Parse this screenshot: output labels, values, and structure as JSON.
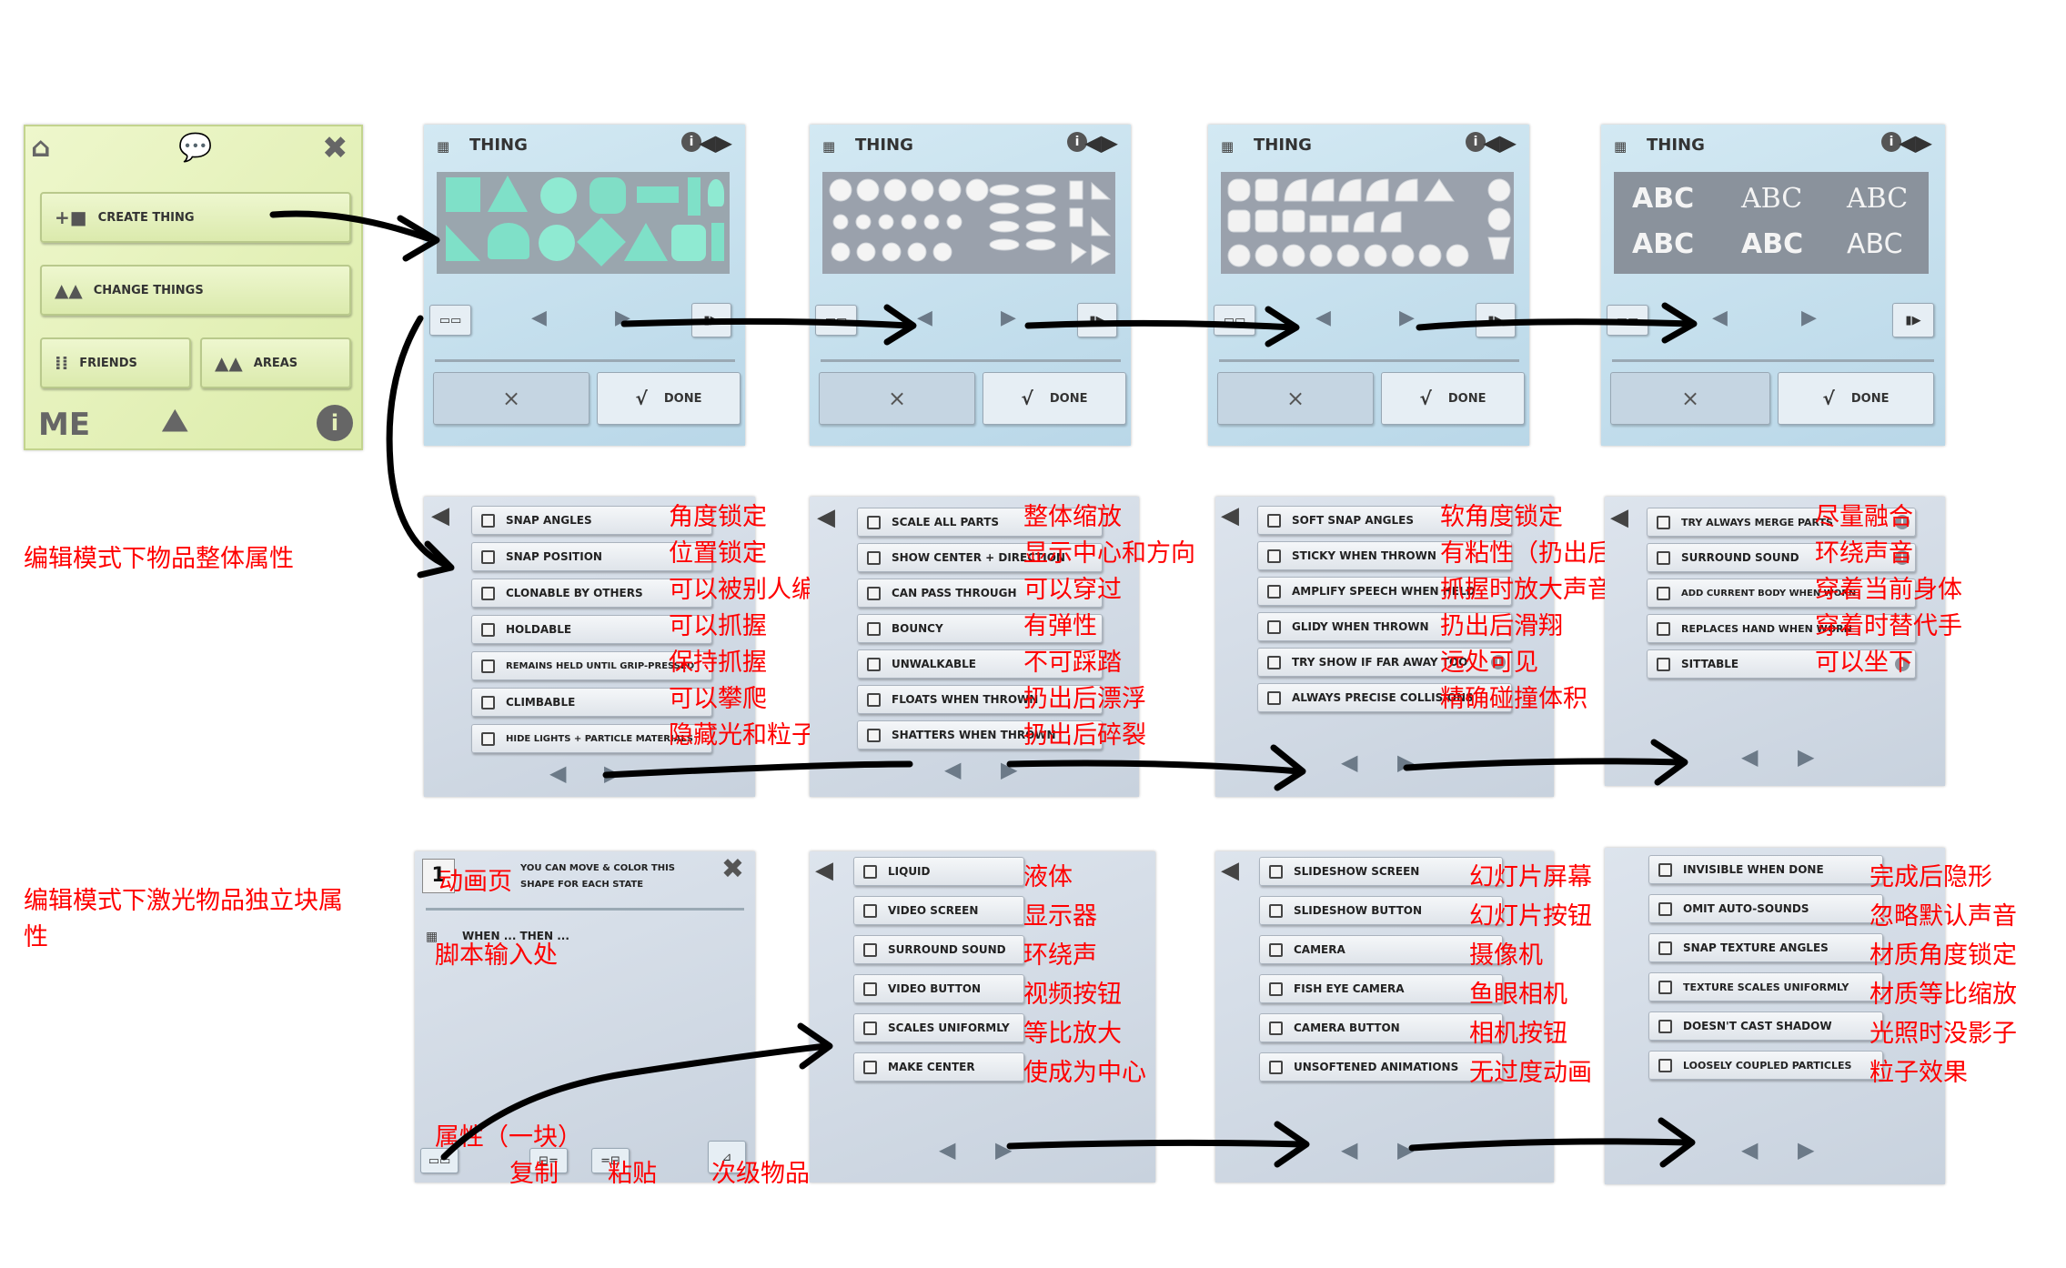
{
  "colors": {
    "annotation": "#ff0000",
    "main_menu_bg": "#e4f0b8",
    "thing_panel_bg": "#c7e0ee",
    "options_panel_bg": "#d2dae4"
  },
  "main_menu": {
    "create_thing": "CREATE THING",
    "change_things": "CHANGE THINGS",
    "friends": "FRIENDS",
    "areas": "AREAS",
    "me": "ME",
    "icons": [
      "home-icon",
      "chat-bubble-icon",
      "close-icon",
      "mountains-icon",
      "info-icon"
    ]
  },
  "thing_panel": {
    "title": "THING",
    "done_label": "DONE",
    "cancel_glyph": "×",
    "done_glyph": "√"
  },
  "text_abc": [
    "ABC",
    "ABC",
    "ABC",
    "ABC",
    "ABC",
    "ABC"
  ],
  "labels": {
    "edit_whole": "编辑模式下物品整体属性",
    "edit_laser_line1": "编辑模式下激光物品独立块属",
    "edit_laser_line2": "性"
  },
  "row1": {
    "options": [
      "SNAP ANGLES",
      "SNAP POSITION",
      "CLONABLE BY OTHERS",
      "HOLDABLE",
      "REMAINS HELD UNTIL GRIP-PRESSED",
      "CLIMBABLE",
      "HIDE LIGHTS + PARTICLE MATERIALS"
    ],
    "cn": [
      "角度锁定",
      "位置锁定",
      "可以被别人编辑",
      "可以抓握",
      "保持抓握",
      "可以攀爬",
      "隐藏光和粒子"
    ]
  },
  "row2": {
    "options": [
      "SCALE ALL PARTS",
      "SHOW CENTER + DIRECTION",
      "CAN PASS THROUGH",
      "BOUNCY",
      "UNWALKABLE",
      "FLOATS WHEN THROWN",
      "SHATTERS WHEN THROWN"
    ],
    "cn": [
      "整体缩放",
      "显示中心和方向",
      "可以穿过",
      "有弹性",
      "不可踩踏",
      "扔出后漂浮",
      "扔出后碎裂"
    ]
  },
  "row3": {
    "options": [
      "SOFT SNAP ANGLES",
      "STICKY WHEN THROWN",
      "AMPLIFY SPEECH WHEN HELD",
      "GLIDY WHEN THROWN",
      "TRY SHOW IF FAR AWAY TOO",
      "ALWAYS PRECISE COLLISIONS"
    ],
    "cn": [
      "软角度锁定",
      "有粘性（扔出后）",
      "抓握时放大声音",
      "扔出后滑翔",
      "远处可见",
      "精确碰撞体积"
    ]
  },
  "row4": {
    "options": [
      "TRY ALWAYS MERGE PARTS",
      "SURROUND SOUND",
      "ADD CURRENT BODY WHEN WORN",
      "REPLACES HAND WHEN WORN",
      "SITTABLE"
    ],
    "cn": [
      "尽量融合",
      "环绕声音",
      "穿着当前身体",
      "穿着时替代手",
      "可以坐下"
    ]
  },
  "part_panel": {
    "note": "YOU CAN MOVE & COLOR THIS SHAPE FOR EACH STATE",
    "state_num": "1",
    "when_then": "WHEN ... THEN ...",
    "cn_anim": "动画页",
    "cn_script": "脚本输入处",
    "cn_props": "属性（一块）",
    "cn_copy": "复制",
    "cn_paste": "粘贴",
    "cn_sub": "次级物品"
  },
  "row5": {
    "options": [
      "LIQUID",
      "VIDEO SCREEN",
      "SURROUND SOUND",
      "VIDEO BUTTON",
      "SCALES UNIFORMLY",
      "MAKE CENTER"
    ],
    "cn": [
      "液体",
      "显示器",
      "环绕声",
      "视频按钮",
      "等比放大",
      "使成为中心"
    ]
  },
  "row6": {
    "options": [
      "SLIDESHOW SCREEN",
      "SLIDESHOW BUTTON",
      "CAMERA",
      "FISH EYE CAMERA",
      "CAMERA BUTTON",
      "UNSOFTENED ANIMATIONS"
    ],
    "cn": [
      "幻灯片屏幕",
      "幻灯片按钮",
      "摄像机",
      "鱼眼相机",
      "相机按钮",
      "无过度动画"
    ]
  },
  "row7": {
    "options": [
      "INVISIBLE WHEN DONE",
      "OMIT AUTO-SOUNDS",
      "SNAP TEXTURE ANGLES",
      "TEXTURE SCALES UNIFORMLY",
      "DOESN'T CAST SHADOW",
      "LOOSELY COUPLED PARTICLES"
    ],
    "cn": [
      "完成后隐形",
      "忽略默认声音",
      "材质角度锁定",
      "材质等比缩放",
      "光照时没影子",
      "粒子效果"
    ]
  }
}
